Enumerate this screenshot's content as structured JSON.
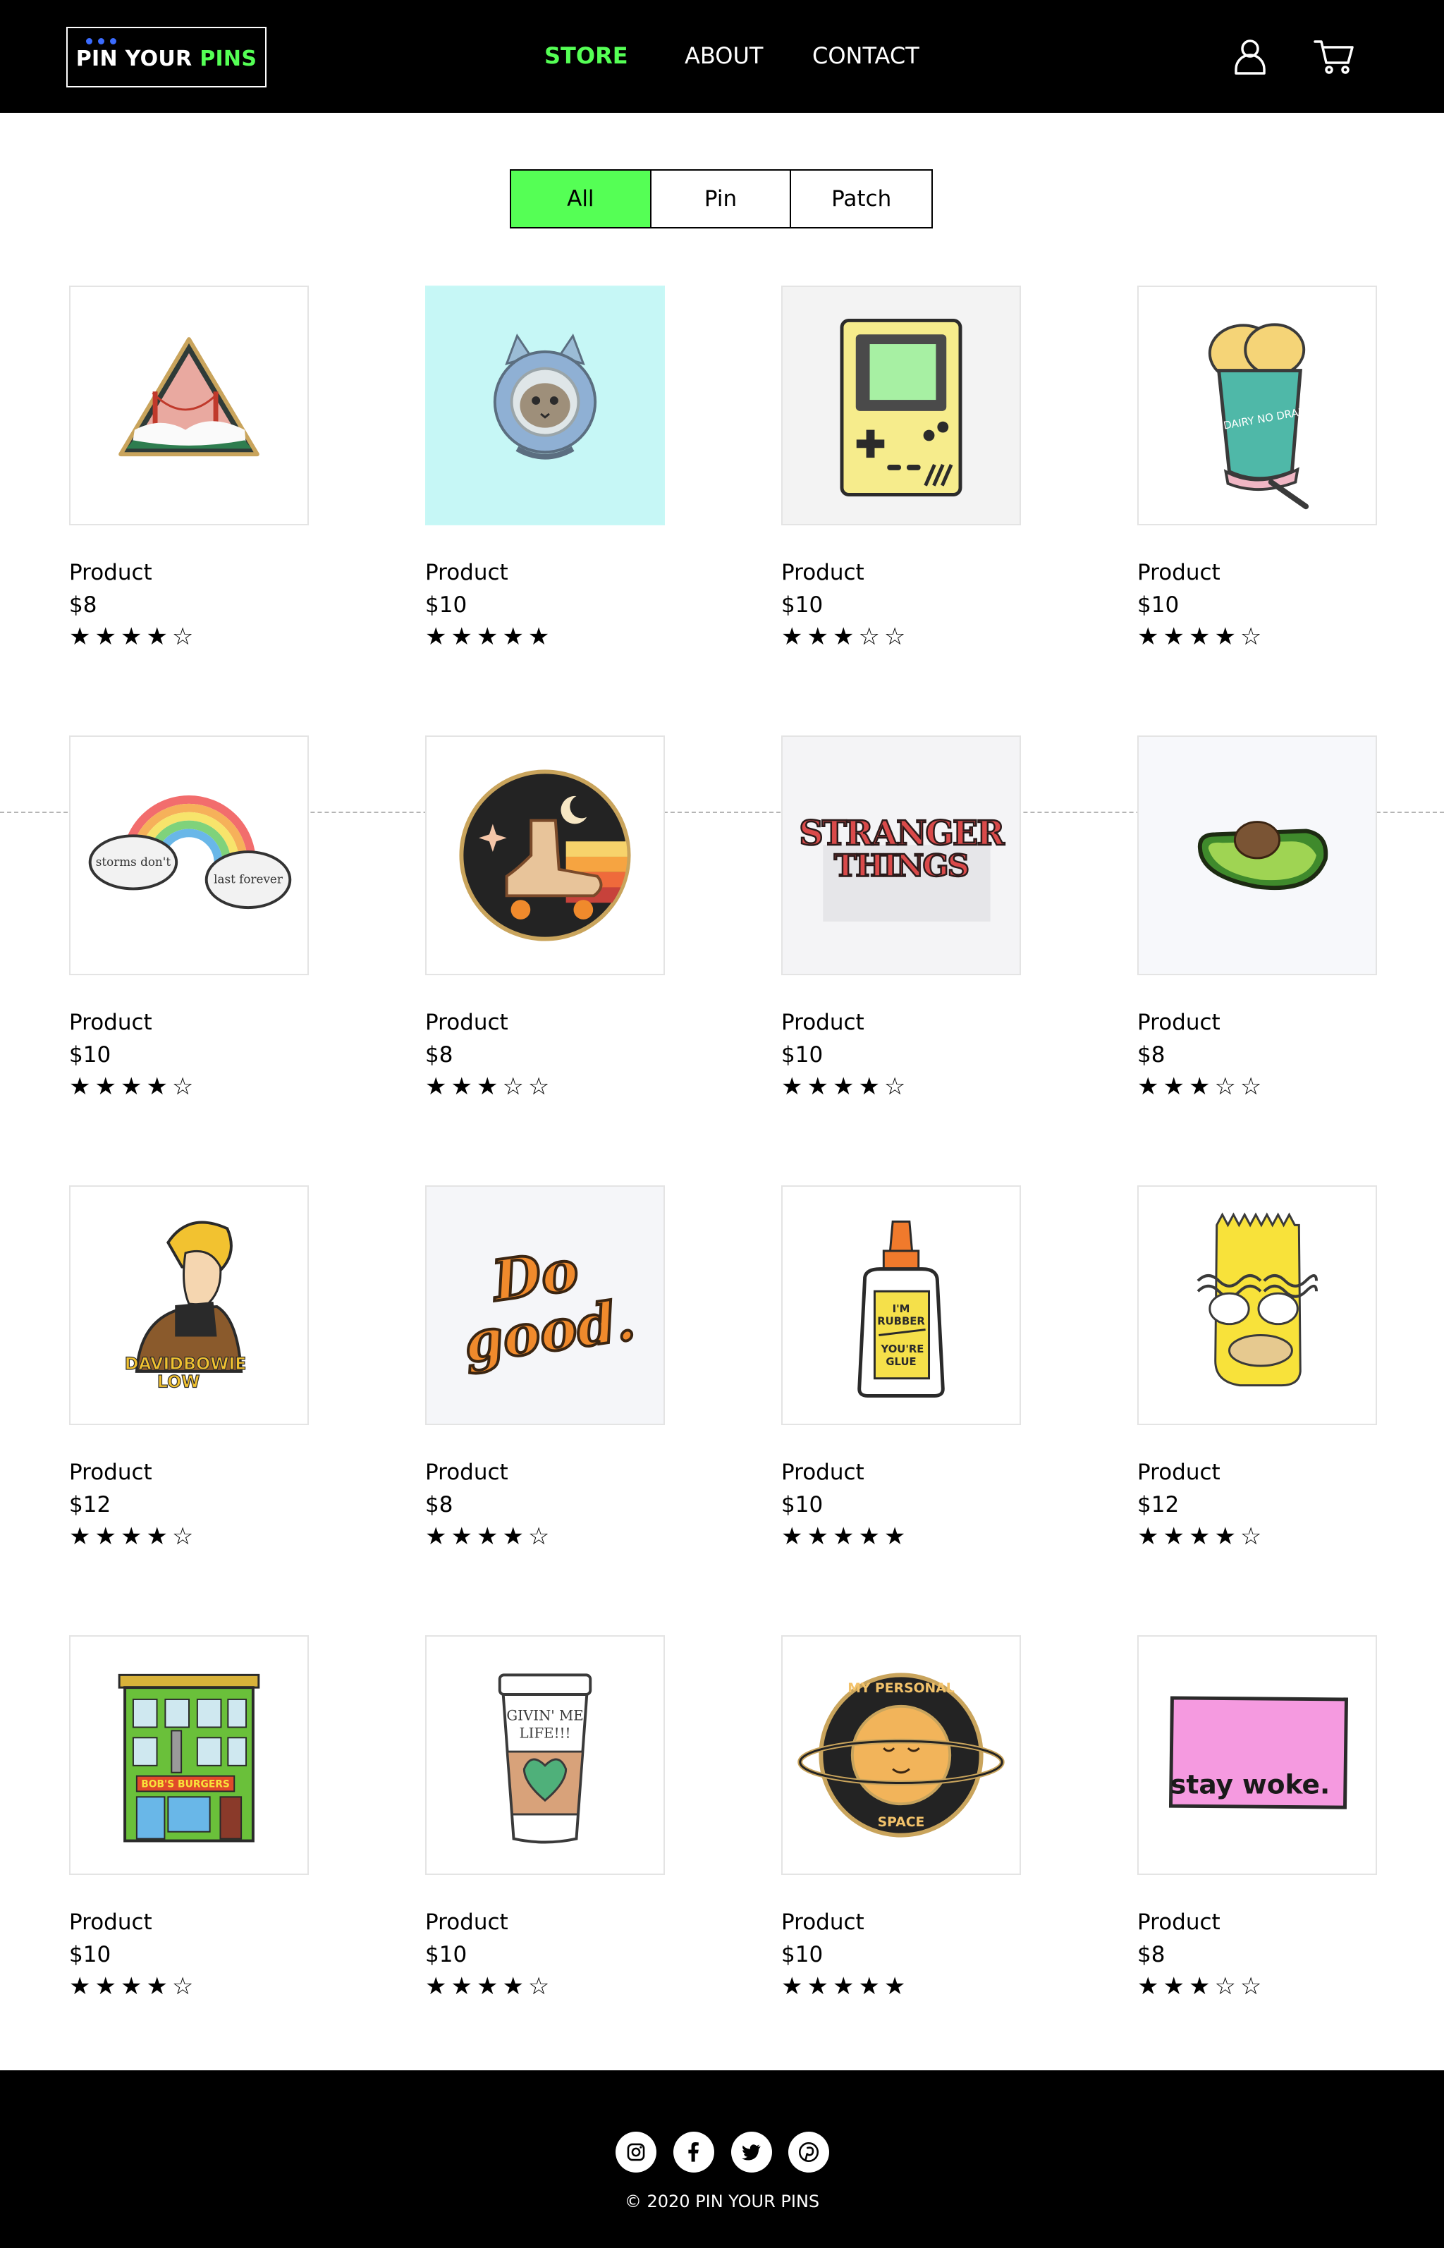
{
  "brand": {
    "part1": "PIN YOUR ",
    "part2": "PINS"
  },
  "nav": {
    "store": "STORE",
    "about": "ABOUT",
    "contact": "CONTACT"
  },
  "header_icons": [
    "user-icon",
    "cart-icon"
  ],
  "colors": {
    "accent": "#55ff55",
    "header_bg": "#000000",
    "logo_dots": "#3b6cff"
  },
  "filters": [
    {
      "label": "All",
      "selected": true
    },
    {
      "label": "Pin",
      "selected": false
    },
    {
      "label": "Patch",
      "selected": false
    }
  ],
  "products": [
    {
      "name": "Product",
      "price": "$8",
      "rating": 4,
      "stars": "★★★★☆",
      "image": "golden-gate-triangle-pin"
    },
    {
      "name": "Product",
      "price": "$10",
      "rating": 5,
      "stars": "★★★★★",
      "image": "astronaut-cat-pin"
    },
    {
      "name": "Product",
      "price": "$10",
      "rating": 3,
      "stars": "★★★☆☆",
      "image": "gameboy-pin"
    },
    {
      "name": "Product",
      "price": "$10",
      "rating": 4,
      "stars": "★★★★☆",
      "image": "no-dairy-no-drama-pin",
      "image_text": "NO DAIRY NO DRAMA"
    },
    {
      "name": "Product",
      "price": "$10",
      "rating": 4,
      "stars": "★★★★☆",
      "image": "rainbow-clouds-pin",
      "image_text": [
        "storms don't",
        "last forever"
      ]
    },
    {
      "name": "Product",
      "price": "$8",
      "rating": 3,
      "stars": "★★★☆☆",
      "image": "roller-skate-pin"
    },
    {
      "name": "Product",
      "price": "$10",
      "rating": 4,
      "stars": "★★★★☆",
      "image": "stranger-things-pin",
      "image_text": [
        "STRANGER",
        "THINGS"
      ]
    },
    {
      "name": "Product",
      "price": "$8",
      "rating": 3,
      "stars": "★★★☆☆",
      "image": "avocado-pin"
    },
    {
      "name": "Product",
      "price": "$12",
      "rating": 4,
      "stars": "★★★★☆",
      "image": "david-bowie-low-pin",
      "image_text": [
        "DAVIDBOWIE",
        "LOW"
      ]
    },
    {
      "name": "Product",
      "price": "$8",
      "rating": 4,
      "stars": "★★★★☆",
      "image": "do-good-pin",
      "image_text": [
        "Do",
        "good."
      ]
    },
    {
      "name": "Product",
      "price": "$10",
      "rating": 5,
      "stars": "★★★★★",
      "image": "glue-bottle-pin",
      "image_text": [
        "I'M",
        "RUBBER",
        "YOU'RE",
        "GLUE"
      ]
    },
    {
      "name": "Product",
      "price": "$12",
      "rating": 4,
      "stars": "★★★★☆",
      "image": "bart-simpson-pin"
    },
    {
      "name": "Product",
      "price": "$10",
      "rating": 4,
      "stars": "★★★★☆",
      "image": "bobs-burgers-building-pin",
      "image_text": "BOB'S BURGERS"
    },
    {
      "name": "Product",
      "price": "$10",
      "rating": 4,
      "stars": "★★★★☆",
      "image": "coffee-cup-pin",
      "image_text": [
        "GIVIN' ME",
        "LIFE!!!"
      ]
    },
    {
      "name": "Product",
      "price": "$10",
      "rating": 5,
      "stars": "★★★★★",
      "image": "my-personal-space-pin",
      "image_text": [
        "MY PERSONAL",
        "SPACE"
      ]
    },
    {
      "name": "Product",
      "price": "$8",
      "rating": 3,
      "stars": "★★★☆☆",
      "image": "stay-woke-patch",
      "image_text": "stay woke."
    }
  ],
  "footer": {
    "social": [
      "instagram-icon",
      "facebook-icon",
      "twitter-icon",
      "pinterest-icon"
    ],
    "copyright": "© 2020 PIN YOUR PINS"
  }
}
